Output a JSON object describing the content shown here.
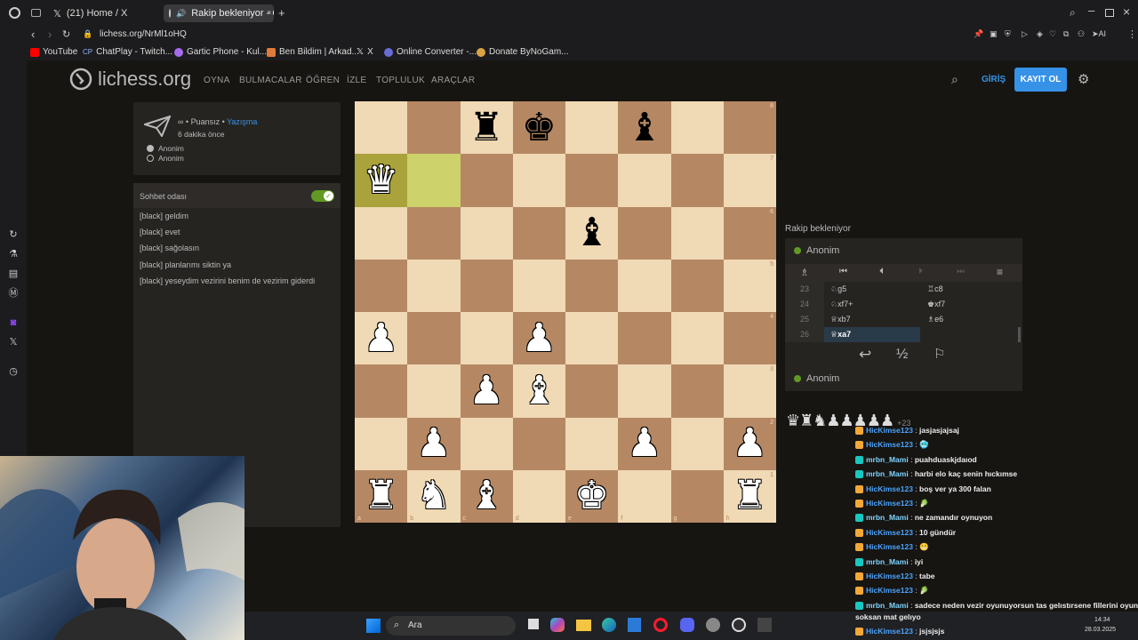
{
  "browser": {
    "tabs": [
      {
        "label": "(21) Home / X"
      },
      {
        "label": "Rakip bekleniyor - Oyu"
      }
    ],
    "url": "lichess.org/NrMl1oHQ",
    "bookmarks": [
      "YouTube",
      "ChatPlay - Twitch...",
      "Gartic Phone - Kul...",
      "Ben Bildim | Arkad...",
      "X",
      "Online Converter -...",
      "Donate ByNoGam..."
    ],
    "ai_label": "AI"
  },
  "site": {
    "logo": "lichess.org",
    "nav": [
      "OYNA",
      "BULMACALAR",
      "ÖĞREN",
      "İZLE",
      "TOPLULUK",
      "ARAÇLAR"
    ],
    "login": "GİRİŞ",
    "signup": "KAYIT OL"
  },
  "game_info": {
    "mode_prefix": "∞ • Puansız •",
    "mode_link": "Yazışma",
    "time_ago": "6 dakika önce",
    "players": [
      "Anonim",
      "Anonim"
    ]
  },
  "chat_room": {
    "title": "Sohbet odası",
    "messages": [
      "[black] geldim",
      "[black] evet",
      "[black] sağolasın",
      "[black] planlarımı siktin ya",
      "[black] yeseydim vezirini benim de vezirim giderdi"
    ]
  },
  "board": {
    "ranks": [
      "8",
      "7",
      "6",
      "5",
      "4",
      "3",
      "2",
      "1"
    ],
    "files": [
      "a",
      "b",
      "c",
      "d",
      "e",
      "f",
      "g",
      "h"
    ],
    "position": [
      [
        "",
        "",
        "bR",
        "bK",
        "",
        "bB",
        "",
        ""
      ],
      [
        "wQ",
        "",
        "",
        "",
        "",
        "",
        "",
        ""
      ],
      [
        "",
        "",
        "",
        "",
        "bB",
        "",
        "",
        ""
      ],
      [
        "",
        "",
        "",
        "",
        "",
        "",
        "",
        ""
      ],
      [
        "wP",
        "",
        "",
        "wP",
        "",
        "",
        "",
        ""
      ],
      [
        "",
        "",
        "wP",
        "wB",
        "",
        "",
        "",
        ""
      ],
      [
        "",
        "wP",
        "",
        "",
        "",
        "wP",
        "",
        "wP"
      ],
      [
        "wR",
        "wN",
        "wB",
        "",
        "wK",
        "",
        "",
        "wR"
      ]
    ],
    "highlight": [
      "a7",
      "b7"
    ]
  },
  "move_panel": {
    "status": "Rakip bekleniyor",
    "top_player": "Anonim",
    "bottom_player": "Anonim",
    "moves": [
      {
        "n": "23",
        "w": "♘g5",
        "b": "♖c8"
      },
      {
        "n": "24",
        "w": "♘xf7+",
        "b": "♚xf7"
      },
      {
        "n": "25",
        "w": "♕xb7",
        "b": "♗e6"
      },
      {
        "n": "26",
        "w": "♕xa7",
        "b": ""
      }
    ],
    "captured": "♛♜♞♟♟♟♟♟",
    "captured_diff": "+23"
  },
  "twitch_chat": [
    {
      "user": "HicKimse123",
      "color": "#4aa3ff",
      "text": "jasjasjajsaj"
    },
    {
      "user": "HicKimse123",
      "color": "#4aa3ff",
      "text": "🥶"
    },
    {
      "user": "mrbn_Mami",
      "color": "#7fd4ff",
      "text": "puahduaskjdaıod"
    },
    {
      "user": "mrbn_Mami",
      "color": "#7fd4ff",
      "text": "harbi elo kaç senin hıckımse"
    },
    {
      "user": "HicKimse123",
      "color": "#4aa3ff",
      "text": "boş ver ya 300 falan"
    },
    {
      "user": "HicKimse123",
      "color": "#4aa3ff",
      "text": "🥬"
    },
    {
      "user": "mrbn_Mami",
      "color": "#7fd4ff",
      "text": "ne zamandır oynuyon"
    },
    {
      "user": "HicKimse123",
      "color": "#4aa3ff",
      "text": "10 gündür"
    },
    {
      "user": "HicKimse123",
      "color": "#4aa3ff",
      "text": "😬"
    },
    {
      "user": "mrbn_Mami",
      "color": "#7fd4ff",
      "text": "iyi"
    },
    {
      "user": "HicKimse123",
      "color": "#4aa3ff",
      "text": "tabe"
    },
    {
      "user": "HicKimse123",
      "color": "#4aa3ff",
      "text": "🥬"
    },
    {
      "user": "mrbn_Mami",
      "color": "#7fd4ff",
      "text": "sadece neden vezir oyunuyorsun tas gelıstırsene fillerini oyuna"
    },
    {
      "user": "",
      "color": "#eee",
      "text": "soksan mat gelıyo"
    },
    {
      "user": "HicKimse123",
      "color": "#4aa3ff",
      "text": "jsjsjsjs"
    }
  ],
  "taskbar": {
    "search": "Ara",
    "time": "14:34",
    "date": "28.03.2025"
  }
}
